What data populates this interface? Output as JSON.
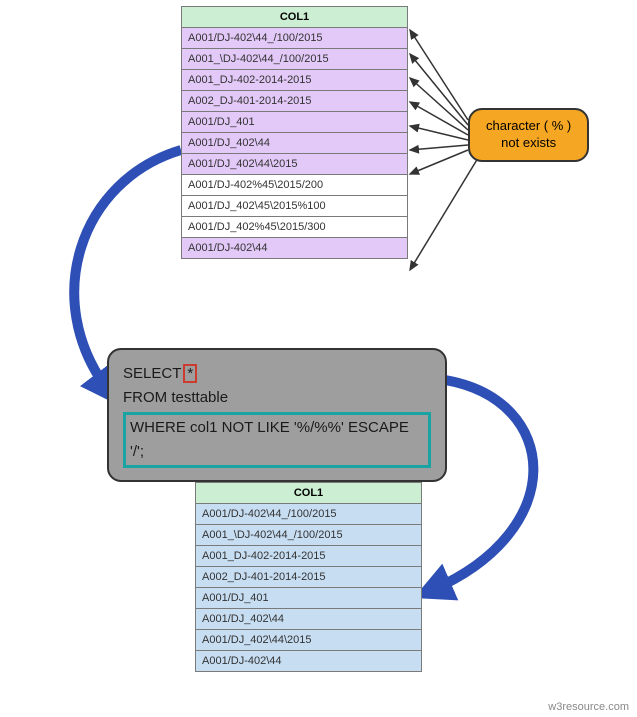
{
  "source_table": {
    "header": "COL1",
    "rows": [
      {
        "value": "A001/DJ-402\\44_/100/2015",
        "match": true
      },
      {
        "value": "A001_\\DJ-402\\44_/100/2015",
        "match": true
      },
      {
        "value": "A001_DJ-402-2014-2015",
        "match": true
      },
      {
        "value": "A002_DJ-401-2014-2015",
        "match": true
      },
      {
        "value": "A001/DJ_401",
        "match": true
      },
      {
        "value": "A001/DJ_402\\44",
        "match": true
      },
      {
        "value": "A001/DJ_402\\44\\2015",
        "match": true
      },
      {
        "value": "A001/DJ-402%45\\2015/200",
        "match": false
      },
      {
        "value": "A001/DJ_402\\45\\2015%100",
        "match": false
      },
      {
        "value": "A001/DJ_402%45\\2015/300",
        "match": false
      },
      {
        "value": "A001/DJ-402\\44",
        "match": true
      }
    ]
  },
  "callout": {
    "line1": "character ( % )",
    "line2": "not exists"
  },
  "sql": {
    "select_kw": "SELECT",
    "star": "*",
    "from_kw": "FROM",
    "table_name": "testtable",
    "where_clause": "WHERE col1   NOT LIKE '%/%%' ESCAPE '/';"
  },
  "result_table": {
    "header": "COL1",
    "rows": [
      "A001/DJ-402\\44_/100/2015",
      "A001_\\DJ-402\\44_/100/2015",
      "A001_DJ-402-2014-2015",
      "A002_DJ-401-2014-2015",
      "A001/DJ_401",
      "A001/DJ_402\\44",
      "A001/DJ_402\\44\\2015",
      "A001/DJ-402\\44"
    ]
  },
  "watermark": "w3resource.com"
}
